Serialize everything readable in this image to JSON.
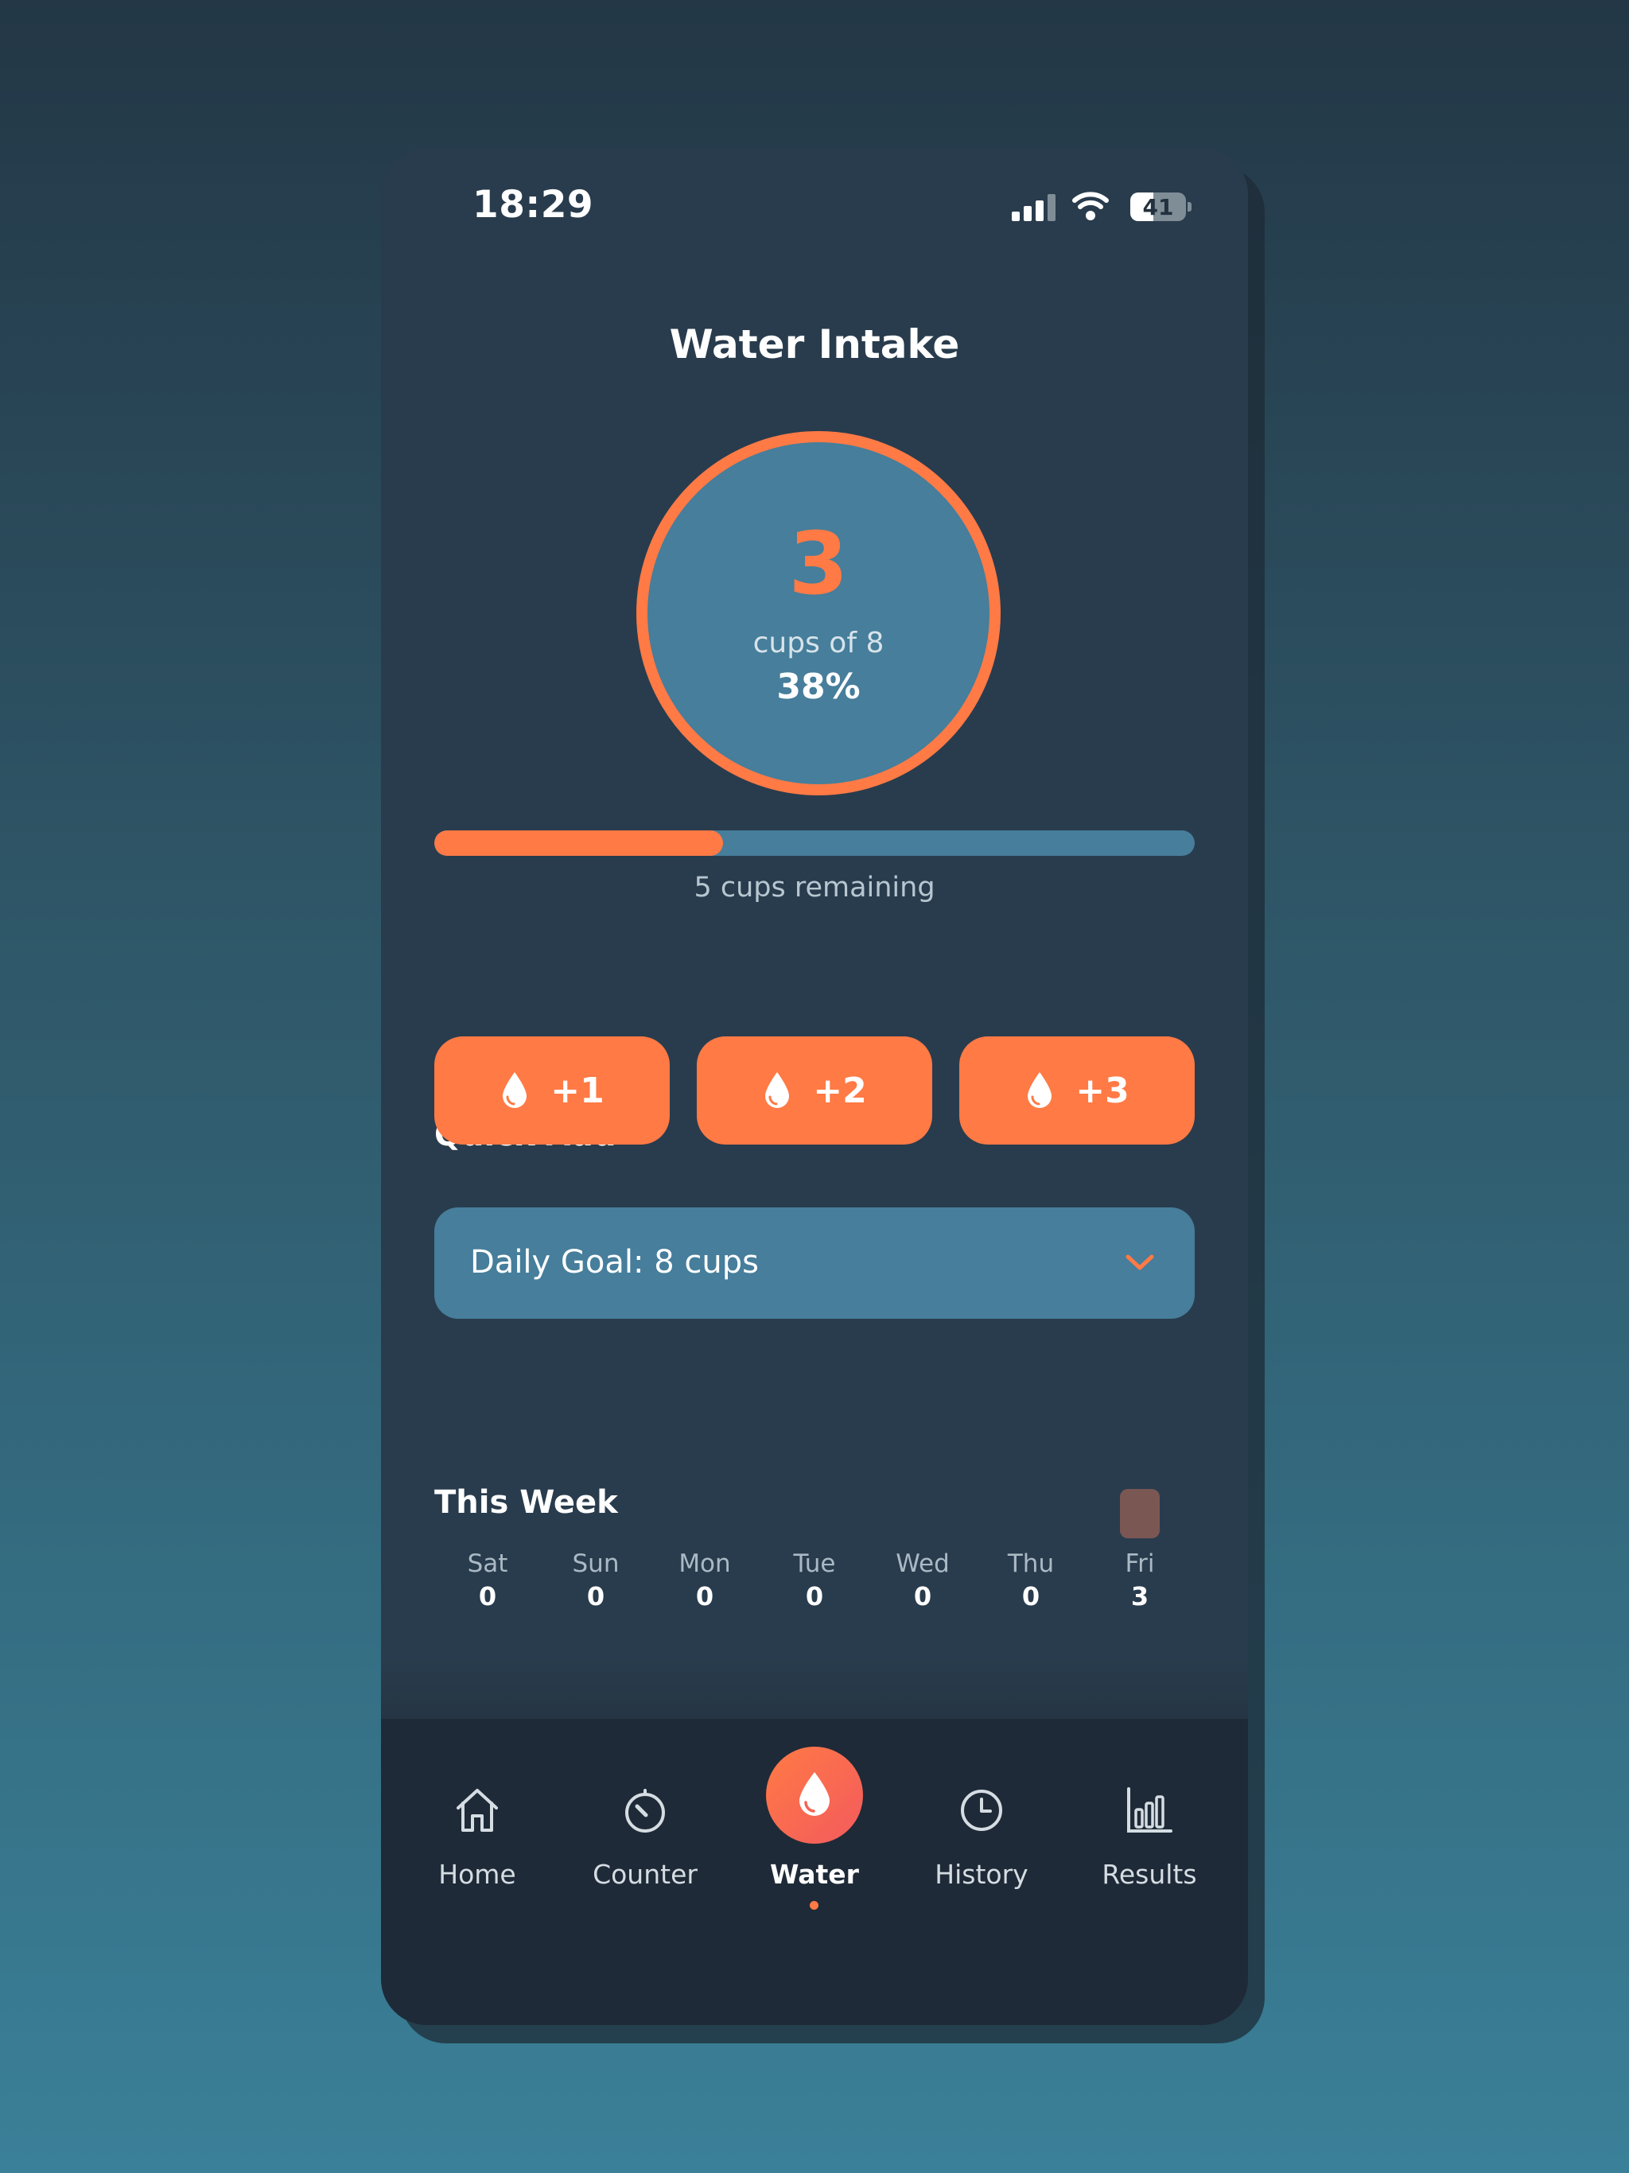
{
  "status_bar": {
    "time": "18:29",
    "battery": "41"
  },
  "title": "Water Intake",
  "progress": {
    "count": "3",
    "subtitle": "cups of 8",
    "percent_label": "38%",
    "fraction": 0.38,
    "remaining": "5 cups remaining"
  },
  "quick_add": {
    "label": "Quick Add",
    "buttons": [
      "+1",
      "+2",
      "+3"
    ]
  },
  "goal": {
    "label": "Daily Goal: 8 cups"
  },
  "week": {
    "label": "This Week",
    "days": [
      {
        "day": "Sat",
        "value": "0"
      },
      {
        "day": "Sun",
        "value": "0"
      },
      {
        "day": "Mon",
        "value": "0"
      },
      {
        "day": "Tue",
        "value": "0"
      },
      {
        "day": "Wed",
        "value": "0"
      },
      {
        "day": "Thu",
        "value": "0"
      },
      {
        "day": "Fri",
        "value": "3"
      }
    ]
  },
  "nav": {
    "items": [
      {
        "label": "Home",
        "icon": "home-icon"
      },
      {
        "label": "Counter",
        "icon": "timer-icon"
      },
      {
        "label": "Water",
        "icon": "water-drop-icon",
        "active": true
      },
      {
        "label": "History",
        "icon": "clock-icon"
      },
      {
        "label": "Results",
        "icon": "bar-chart-icon"
      }
    ]
  },
  "colors": {
    "accent": "#ff7a45",
    "card": "#467e9b",
    "phone_bg": "#293c4d",
    "nav_bg": "#1e2a37",
    "week_bar": "#7b5754"
  }
}
